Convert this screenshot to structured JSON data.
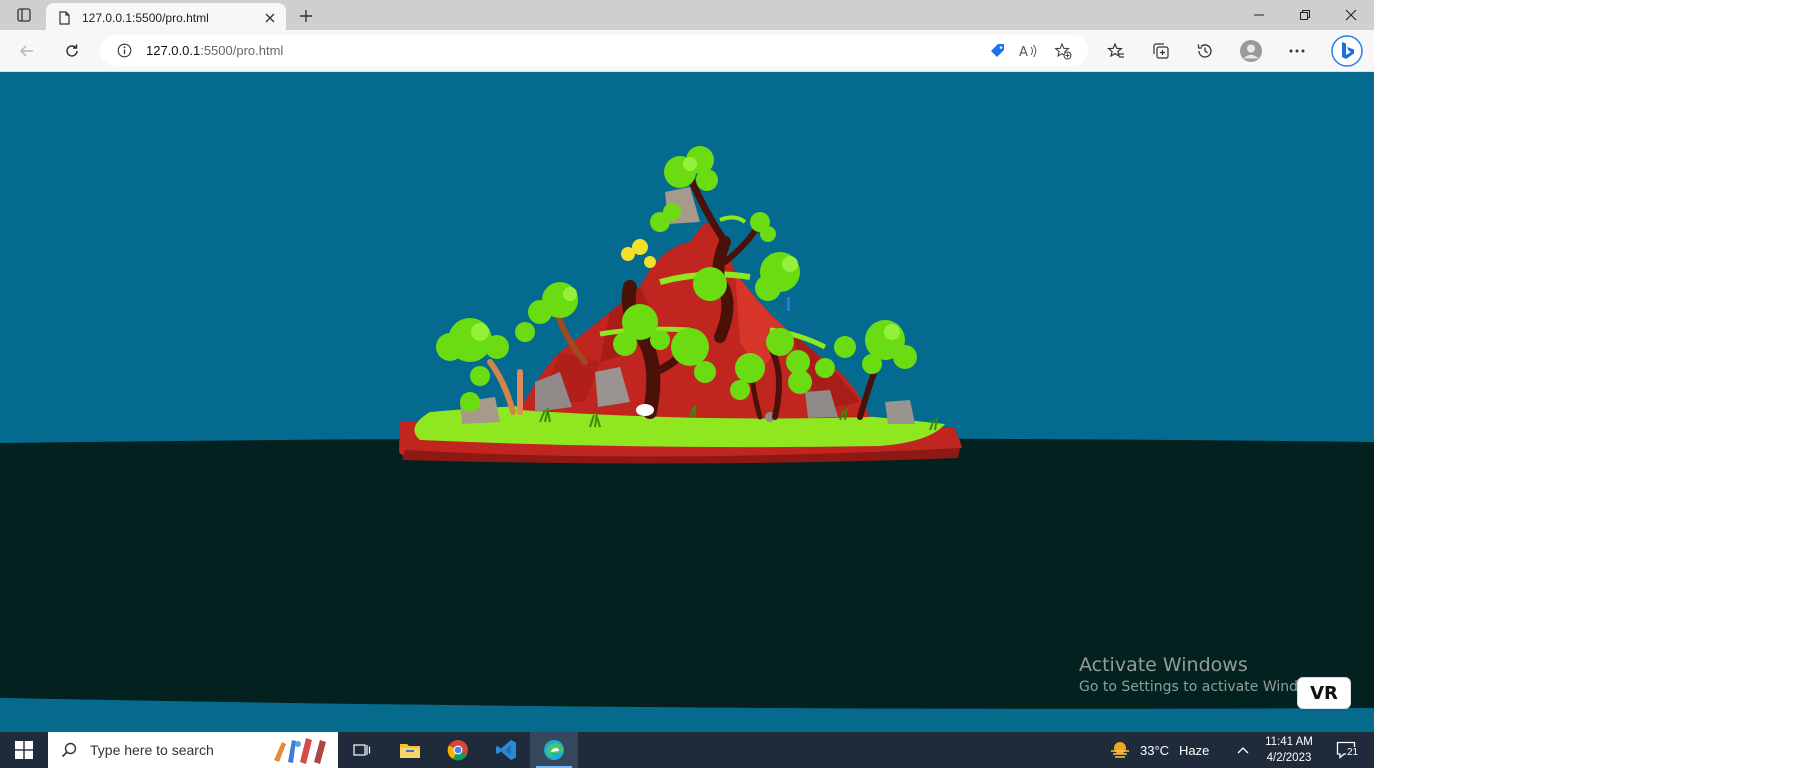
{
  "browser": {
    "tab_title": "127.0.0.1:5500/pro.html",
    "url_host": "127.0.0.1",
    "url_rest": ":5500/pro.html"
  },
  "icons": {
    "tab_actions": "tab-actions-icon",
    "page": "page-icon",
    "close": "close-icon",
    "new_tab": "plus-icon",
    "minimize": "minimize-icon",
    "restore": "restore-icon",
    "back": "back-arrow-icon",
    "refresh": "refresh-icon",
    "info": "info-icon",
    "shopping": "shopping-tag-icon",
    "read_aloud": "read-aloud-icon",
    "add_favorite": "add-favorite-icon",
    "favorites": "favorites-icon",
    "collections": "collections-icon",
    "history": "history-icon",
    "profile": "profile-icon",
    "more": "more-icon",
    "bing": "bing-icon",
    "windows": "windows-logo-icon",
    "search": "search-icon",
    "task_view": "task-view-icon",
    "file_explorer": "file-explorer-icon",
    "chrome": "chrome-icon",
    "vscode": "vscode-icon",
    "edge": "edge-icon",
    "weather": "weather-haze-icon",
    "tray_chevron": "chevron-up-icon",
    "notifications": "notification-icon"
  },
  "colors": {
    "sky": "#046a8f",
    "sea": "#03211e",
    "island_red": "#c0251f",
    "grass": "#8fe81f",
    "foliage": "#6bdc12",
    "taskbar": "#1f2a3a"
  },
  "page": {
    "vr_label": "VR",
    "watermark_title": "Activate Windows",
    "watermark_sub": "Go to Settings to activate Windows."
  },
  "taskbar": {
    "search_placeholder": "Type here to search",
    "weather_temp": "33°C",
    "weather_cond": "Haze",
    "time": "11:41 AM",
    "date": "4/2/2023",
    "notification_count": "21"
  }
}
